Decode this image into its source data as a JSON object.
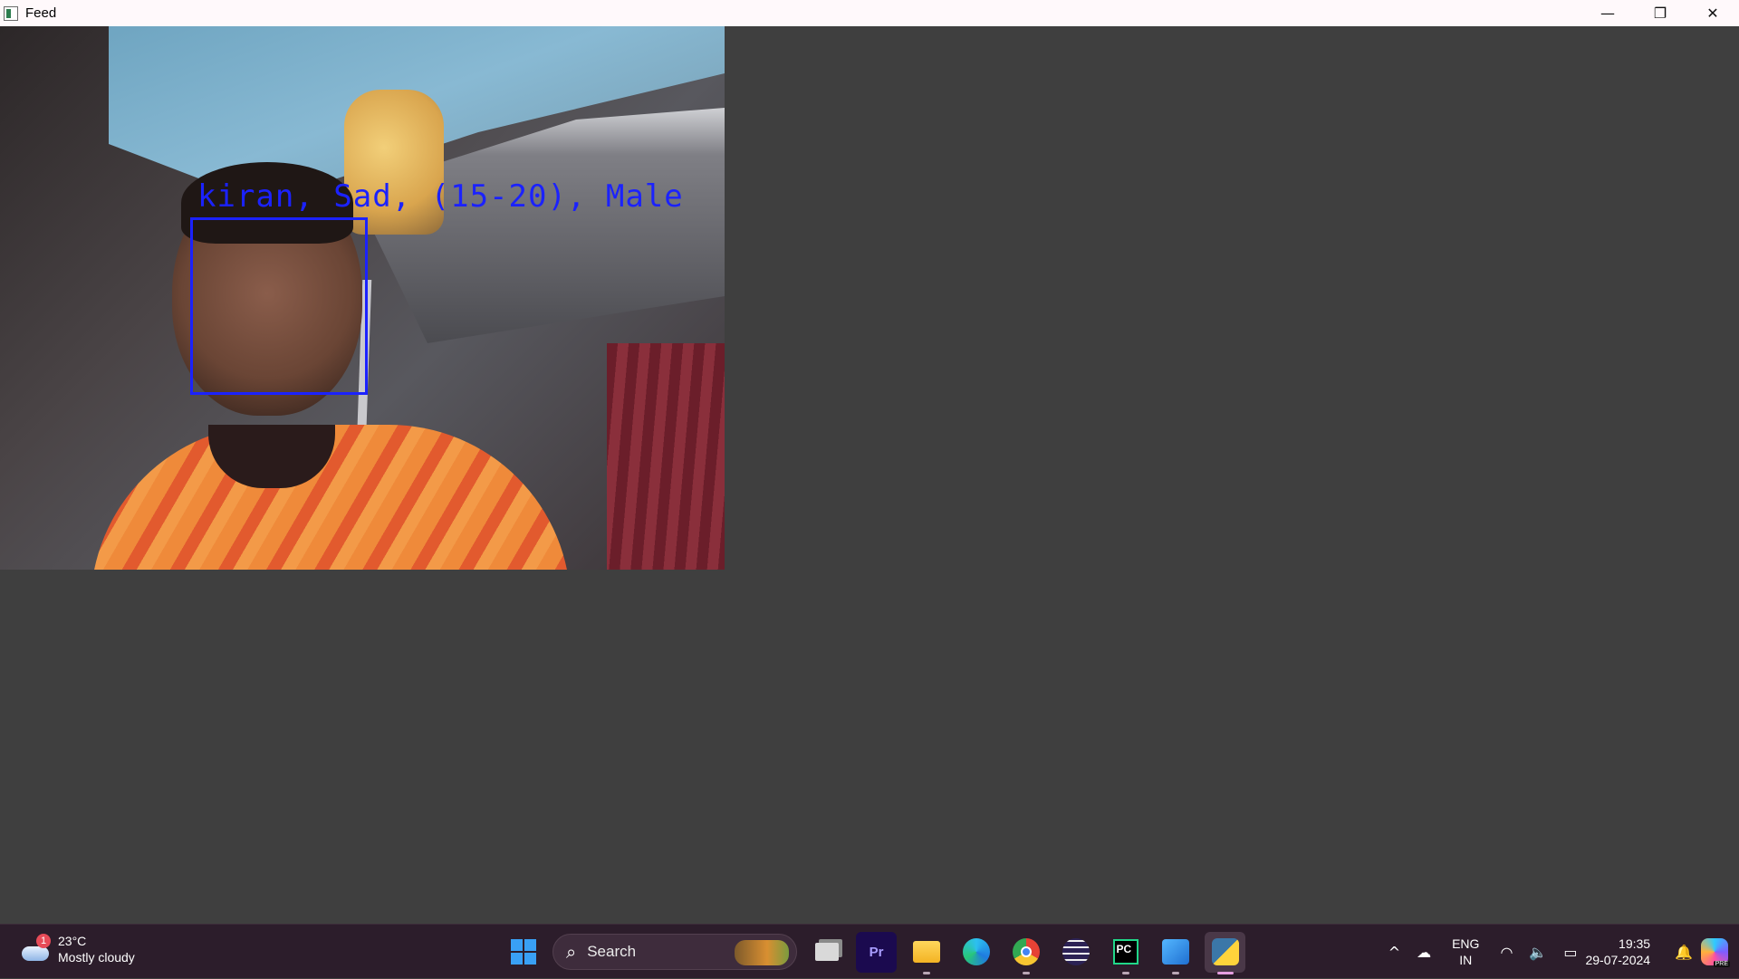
{
  "window": {
    "title": "Feed",
    "minimize_glyph": "—",
    "restore_glyph": "❐",
    "close_glyph": "✕"
  },
  "feed": {
    "face_label": "kiran, Sad, (15-20), Male",
    "box_color": "#1b22ff"
  },
  "taskbar": {
    "weather": {
      "badge": "1",
      "temperature": "23°C",
      "condition": "Mostly cloudy"
    },
    "search": {
      "label": "Search"
    },
    "apps": [
      {
        "name": "start",
        "icon": "windows-logo-icon"
      },
      {
        "name": "search",
        "icon": "search-icon"
      },
      {
        "name": "task-view",
        "icon": "task-view-icon"
      },
      {
        "name": "premiere-pro",
        "icon": "premiere-pro-icon",
        "text": "Pr"
      },
      {
        "name": "file-explorer",
        "icon": "folder-icon"
      },
      {
        "name": "edge",
        "icon": "edge-icon"
      },
      {
        "name": "chrome",
        "icon": "chrome-icon"
      },
      {
        "name": "eclipse",
        "icon": "eclipse-icon"
      },
      {
        "name": "pycharm",
        "icon": "pycharm-icon",
        "text": "PC"
      },
      {
        "name": "photos",
        "icon": "photos-icon"
      },
      {
        "name": "python",
        "icon": "python-icon"
      }
    ],
    "tray": {
      "language_line1": "ENG",
      "language_line2": "IN",
      "time": "19:35",
      "date": "29-07-2024",
      "chevron": "^"
    }
  },
  "colors": {
    "background": "#3f3f3f",
    "taskbar": "#2c1d2b",
    "titlebar": "#fff9fb"
  }
}
